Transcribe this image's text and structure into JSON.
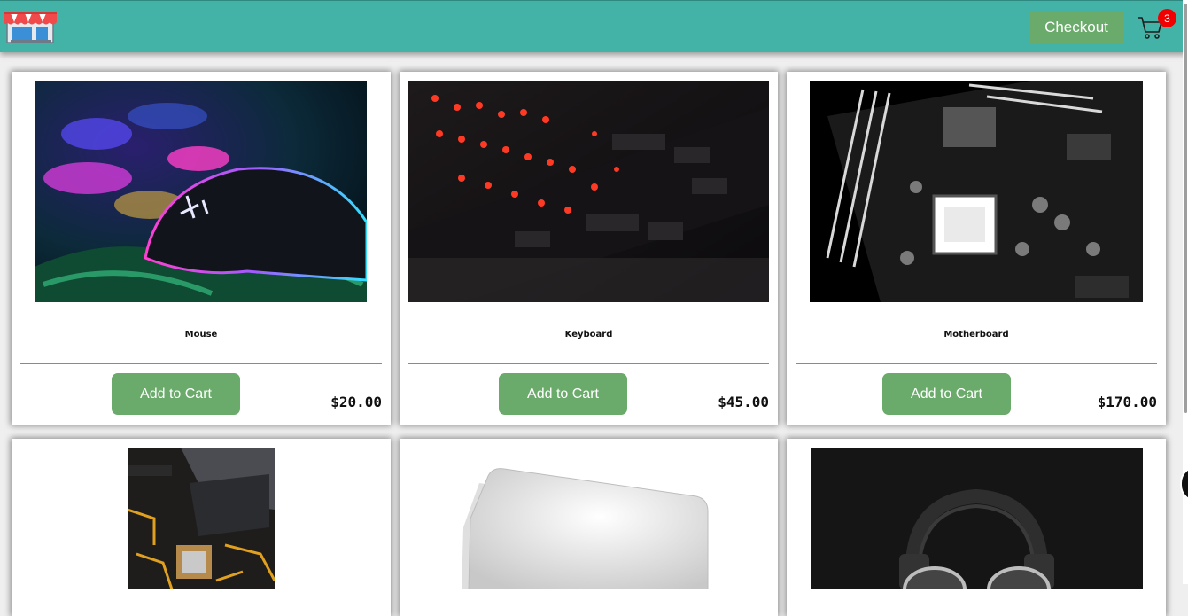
{
  "header": {
    "logo_icon": "storefront-icon",
    "checkout_label": "Checkout",
    "cart_icon": "shopping-cart-icon",
    "cart_count": "3",
    "colors": {
      "bar": "#42b3a6",
      "button": "#6aaa6a",
      "badge": "#f00000"
    }
  },
  "products": [
    {
      "name": "Mouse",
      "price": "$20.00",
      "button_label": "Add to Cart",
      "image": "gaming-mouse-photo"
    },
    {
      "name": "Keyboard",
      "price": "$45.00",
      "button_label": "Add to Cart",
      "image": "backlit-keyboard-photo"
    },
    {
      "name": "Motherboard",
      "price": "$170.00",
      "button_label": "Add to Cart",
      "image": "motherboard-photo"
    },
    {
      "image": "cpu-on-motherboard-photo"
    },
    {
      "image": "mousepad-photo"
    },
    {
      "image": "headphones-photo"
    }
  ]
}
